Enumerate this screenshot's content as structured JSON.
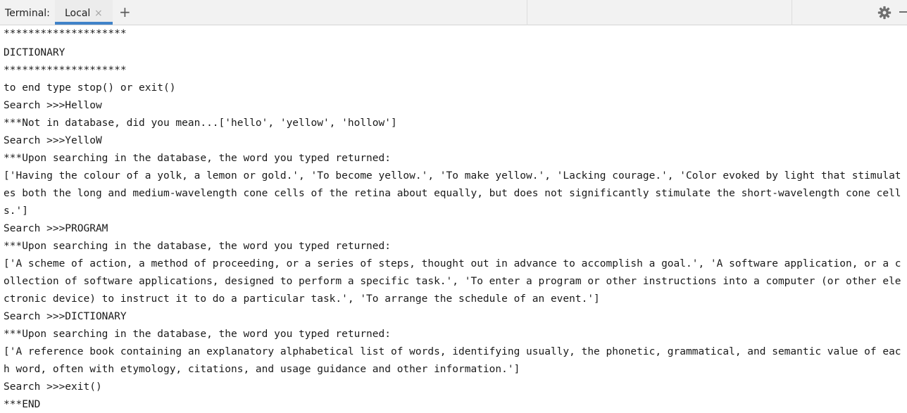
{
  "header": {
    "title": "Terminal:",
    "tabs": [
      {
        "label": "Local",
        "close_icon": "×"
      }
    ],
    "add_tab_icon": "+"
  },
  "terminal": {
    "lines": [
      "********************",
      "DICTIONARY",
      "********************",
      "to end type stop() or exit()",
      "Search >>>Hellow",
      "***Not in database, did you mean...['hello', 'yellow', 'hollow']",
      "Search >>>YelloW",
      "***Upon searching in the database, the word you typed returned:",
      "['Having the colour of a yolk, a lemon or gold.', 'To become yellow.', 'To make yellow.', 'Lacking courage.', 'Color evoked by light that stimulat",
      "es both the long and medium-wavelength cone cells of the retina about equally, but does not significantly stimulate the short-wavelength cone cell",
      "s.']",
      "Search >>>PROGRAM",
      "***Upon searching in the database, the word you typed returned:",
      "['A scheme of action, a method of proceeding, or a series of steps, thought out in advance to accomplish a goal.', 'A software application, or a c",
      "ollection of software applications, designed to perform a specific task.', 'To enter a program or other instructions into a computer (or other ele",
      "ctronic device) to instruct it to do a particular task.', 'To arrange the schedule of an event.']",
      "Search >>>DICTIONARY",
      "***Upon searching in the database, the word you typed returned:",
      "['A reference book containing an explanatory alphabetical list of words, identifying usually, the phonetic, grammatical, and semantic value of eac",
      "h word, often with etymology, citations, and usage guidance and other information.']",
      "Search >>>exit()",
      "***END"
    ]
  },
  "icons": {
    "settings": "gear-icon",
    "hide": "minus-icon"
  },
  "colors": {
    "accent": "#4083c9",
    "tabbar_bg": "#f2f2f2",
    "text": "#1a1a1a"
  }
}
